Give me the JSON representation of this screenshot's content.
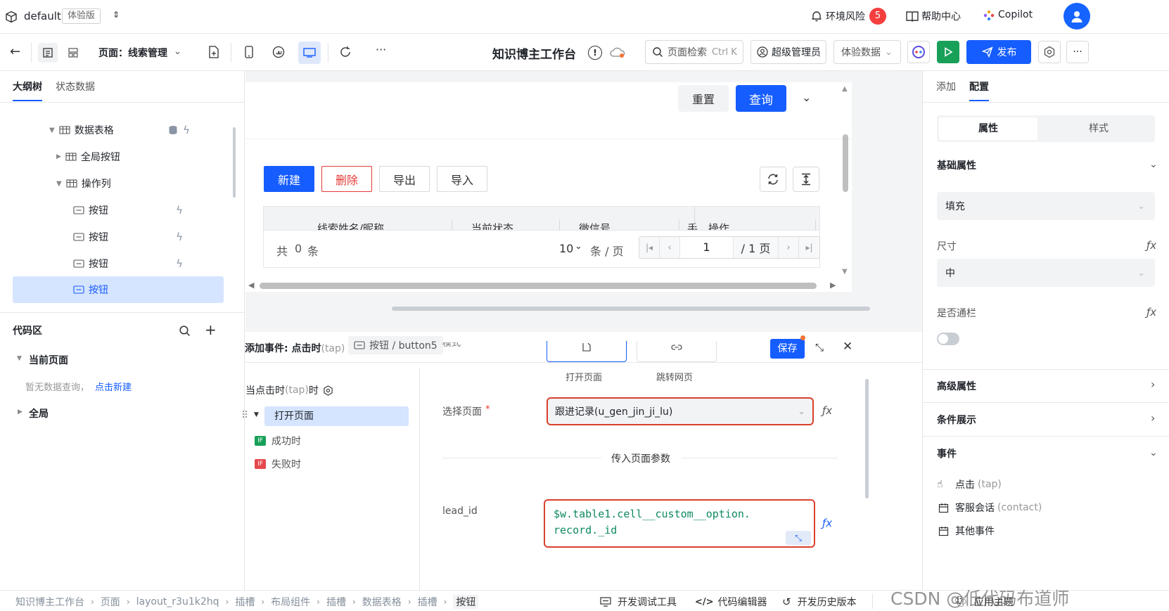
{
  "topbar": {
    "app_name": "default",
    "edition_badge": "体验版",
    "env_risk_label": "环境风险",
    "env_risk_count": "5",
    "help_label": "帮助中心",
    "copilot_label": "Copilot"
  },
  "toolbar": {
    "page_label": "页面：线索管理",
    "app_title": "知识博主工作台",
    "search_placeholder": "页面检索",
    "search_shortcut": "Ctrl K",
    "role_label": "超级管理员",
    "data_label": "体验数据",
    "publish_label": "发布",
    "more": "···"
  },
  "left": {
    "tabs": [
      "大纲树",
      "状态数据"
    ],
    "tree": [
      {
        "label": "数据表格",
        "indent": 1
      },
      {
        "label": "全局按钮",
        "indent": 2
      },
      {
        "label": "操作列",
        "indent": 2
      },
      {
        "label": "按钮",
        "indent": 3
      },
      {
        "label": "按钮",
        "indent": 3
      },
      {
        "label": "按钮",
        "indent": 3
      },
      {
        "label": "按钮",
        "indent": 3
      }
    ],
    "code_title": "代码区",
    "current_page": "当前页面",
    "empty_text": "暂无数据查询，",
    "create_link": "点击新建",
    "global": "全局"
  },
  "canvas": {
    "reset": "重置",
    "query": "查询",
    "btn_new": "新建",
    "btn_delete": "删除",
    "btn_export": "导出",
    "btn_import": "导入",
    "columns": [
      "线索姓名/昵称",
      "当前状态",
      "微信号",
      "手",
      "操作"
    ],
    "total_prefix": "共",
    "total_count": "0",
    "total_suffix": "条",
    "page_size": "10",
    "per_page": "条 / 页",
    "page_input": "1",
    "page_total": "/ 1 页"
  },
  "event": {
    "title": "添加事件: 点击时",
    "title_sub": "(tap)",
    "crumb": "按钮 / button5",
    "save": "保存",
    "when_label": "当点击时",
    "when_sub": "(tap)",
    "when_suffix": "时",
    "action_open": "打开页面",
    "success": "成功时",
    "failure": "失败时",
    "if_badge": "IF",
    "mode_label": "模式",
    "opt_open_page": "打开页面",
    "opt_jump_web": "跳转网页",
    "select_page_label": "选择页面",
    "required_mark": "*",
    "select_page_value": "跟进记录(u_gen_jin_ji_lu)",
    "params_divider": "传入页面参数",
    "param_name": "lead_id",
    "param_value_line1": "$w.table1.cell__custom__option.",
    "param_value_line2": "record._id",
    "fx": "ƒx"
  },
  "right": {
    "tabs": [
      "添加",
      "配置"
    ],
    "subtabs": [
      "属性",
      "样式"
    ],
    "basic": "基础属性",
    "fill_value": "填充",
    "size_label": "尺寸",
    "size_value": "中",
    "banner_label": "是否通栏",
    "advanced": "高级属性",
    "conditional": "条件展示",
    "events": "事件",
    "event_tap": "点击",
    "event_tap_sub": "(tap)",
    "event_contact": "客服会话",
    "event_contact_sub": "(contact)",
    "event_other": "其他事件"
  },
  "status": {
    "breadcrumbs": [
      "知识博主工作台",
      "页面",
      "layout_r3u1k2hq",
      "插槽",
      "布局组件",
      "插槽",
      "数据表格",
      "插槽",
      "按钮"
    ],
    "dev_tools": "开发调试工具",
    "code_editor": "代码编辑器",
    "history": "开发历史版本",
    "theme": "应用主题",
    "watermark": "CSDN @低代码布道师"
  },
  "colors": {
    "primary": "#165dff",
    "danger": "#e53935",
    "publish_green": "#18a058",
    "highlight_bg": "#d5e4ff"
  }
}
